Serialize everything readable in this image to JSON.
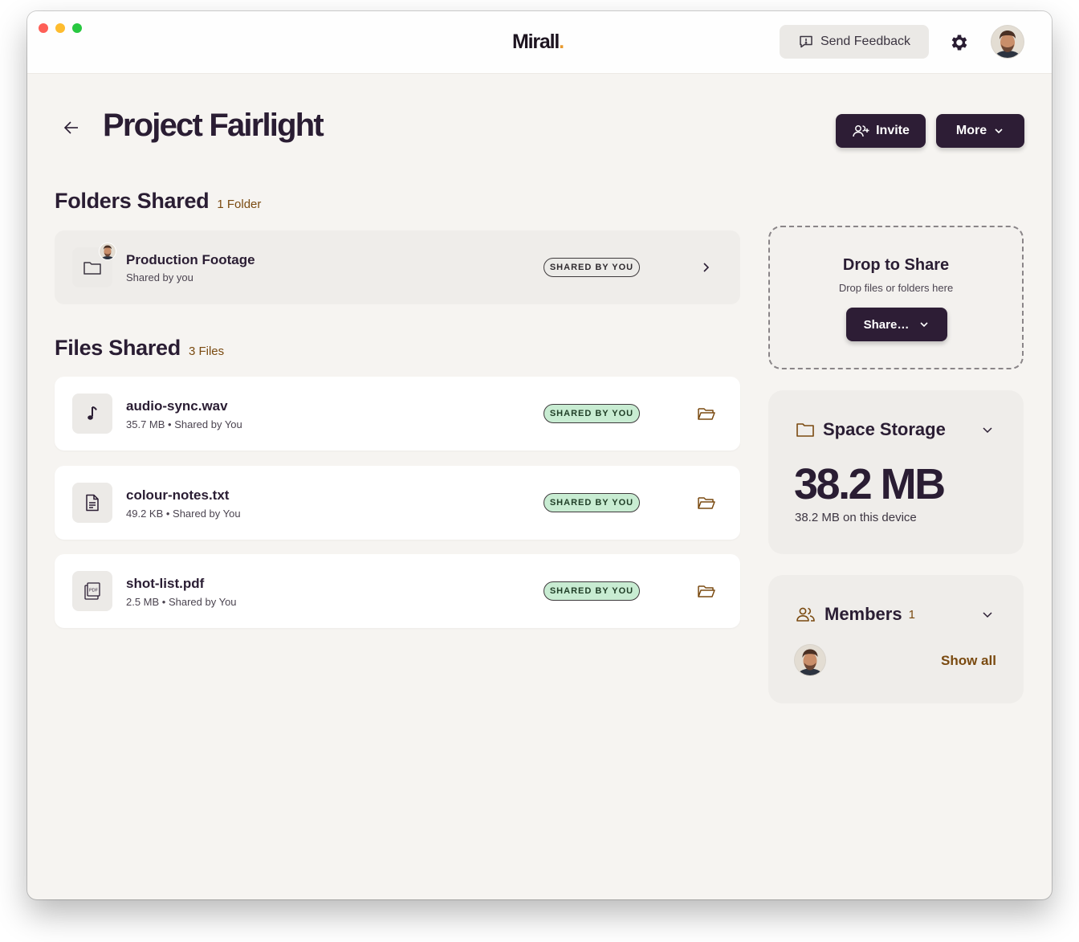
{
  "app": {
    "logo_text": "Mirall",
    "logo_dot": ".",
    "accent_color": "#e89a2e"
  },
  "header": {
    "feedback_label": "Send Feedback"
  },
  "page": {
    "title": "Project Fairlight",
    "invite_label": "Invite",
    "more_label": "More"
  },
  "folders": {
    "title": "Folders Shared",
    "count": "1 Folder",
    "items": [
      {
        "name": "Production Footage",
        "meta": "Shared by you",
        "badge": "SHARED BY YOU"
      }
    ]
  },
  "files": {
    "title": "Files Shared",
    "count": "3 Files",
    "items": [
      {
        "name": "audio-sync.wav",
        "meta": "35.7 MB • Shared by You",
        "badge": "SHARED BY YOU",
        "icon": "music-note-icon"
      },
      {
        "name": "colour-notes.txt",
        "meta": "49.2 KB • Shared by You",
        "badge": "SHARED BY YOU",
        "icon": "text-file-icon"
      },
      {
        "name": "shot-list.pdf",
        "meta": "2.5 MB • Shared by You",
        "badge": "SHARED BY YOU",
        "icon": "pdf-file-icon",
        "icon_label": "PDF"
      }
    ]
  },
  "drop_zone": {
    "title": "Drop to Share",
    "subtitle": "Drop files or folders here",
    "share_label": "Share…"
  },
  "storage": {
    "title": "Space Storage",
    "value": "38.2 MB",
    "subtitle": "38.2 MB on this device"
  },
  "members": {
    "title": "Members",
    "count": "1",
    "show_all": "Show all"
  }
}
